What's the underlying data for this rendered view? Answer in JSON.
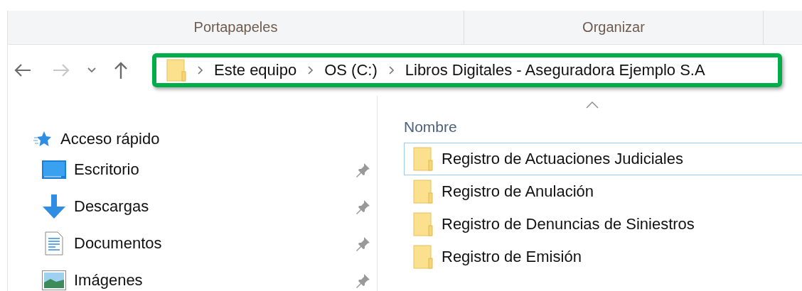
{
  "ribbon": {
    "groups": [
      "Portapapeles",
      "Organizar"
    ]
  },
  "navigation": {
    "back": {
      "disabled": false
    },
    "forward": {
      "disabled": true
    },
    "up": {
      "disabled": false
    }
  },
  "address_bar": {
    "highlighted": true,
    "crumbs": [
      "Este equipo",
      "OS (C:)",
      "Libros Digitales - Aseguradora Ejemplo S.A"
    ]
  },
  "sidebar": {
    "section": "Acceso rápido",
    "items": [
      {
        "label": "Escritorio",
        "kind": "desktop",
        "pinned": true
      },
      {
        "label": "Descargas",
        "kind": "downloads",
        "pinned": true
      },
      {
        "label": "Documentos",
        "kind": "documents",
        "pinned": true
      },
      {
        "label": "Imágenes",
        "kind": "pictures",
        "pinned": true
      }
    ]
  },
  "file_list": {
    "columns": [
      {
        "label": "Nombre",
        "sorted": true
      }
    ],
    "rows": [
      {
        "name": "Registro de Actuaciones Judiciales",
        "focused": true
      },
      {
        "name": "Registro de Anulación",
        "focused": false
      },
      {
        "name": "Registro de Denuncias de Siniestros",
        "focused": false
      },
      {
        "name": "Registro de Emisión",
        "focused": false
      }
    ]
  }
}
